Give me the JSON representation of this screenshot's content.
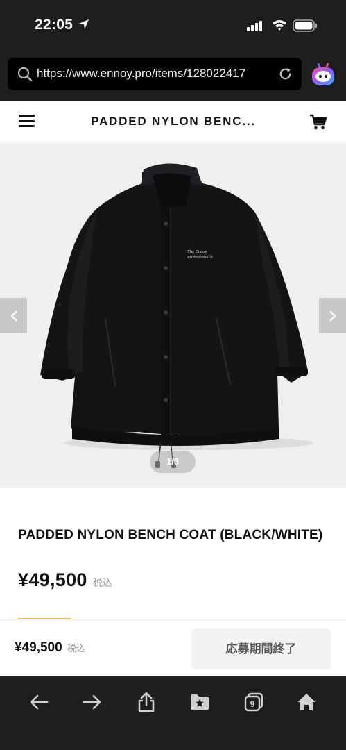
{
  "status_bar": {
    "time": "22:05"
  },
  "browser": {
    "url": "https://www.ennoy.pro/items/128022417",
    "tab_count": "9"
  },
  "header": {
    "title": "PADDED NYLON BENC..."
  },
  "gallery": {
    "counter": "1/6",
    "coat_print_line1": "The Ennoy",
    "coat_print_line2": "Professional®"
  },
  "product": {
    "title": "PADDED NYLON BENCH COAT (BLACK/WHITE)",
    "price": "¥49,500",
    "tax_label": "税込"
  },
  "buy_bar": {
    "price": "¥49,500",
    "tax_label": "税込",
    "button_label": "応募期間終了"
  },
  "colors": {
    "chrome": "#1e1e1e",
    "accent": "#e8c45a",
    "button_bg": "#f1f2f4"
  },
  "icons": [
    "location-arrow-icon",
    "signal-icon",
    "wifi-icon",
    "battery-icon",
    "search-icon",
    "reload-icon",
    "extension-icon",
    "hamburger-menu-icon",
    "cart-icon",
    "chevron-left-icon",
    "chevron-right-icon",
    "back-icon",
    "forward-icon",
    "share-icon",
    "bookmarks-icon",
    "tabs-icon",
    "home-icon"
  ]
}
